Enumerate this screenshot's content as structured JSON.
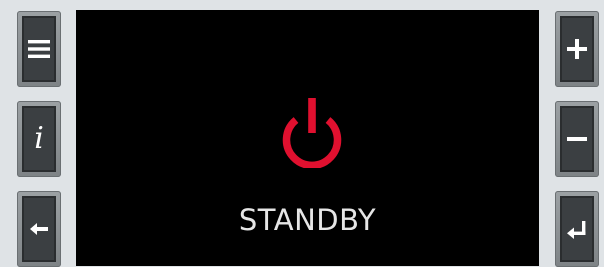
{
  "screen": {
    "status_label": "STANDBY",
    "power_icon": "power-icon",
    "power_color": "#e0102f",
    "background": "#000000"
  },
  "left_buttons": [
    {
      "name": "menu-button",
      "icon": "hamburger-menu-icon"
    },
    {
      "name": "info-button",
      "icon": "info-icon",
      "glyph": "i"
    },
    {
      "name": "back-button",
      "icon": "arrow-left-icon"
    }
  ],
  "right_buttons": [
    {
      "name": "plus-button",
      "icon": "plus-icon"
    },
    {
      "name": "minus-button",
      "icon": "minus-icon"
    },
    {
      "name": "enter-button",
      "icon": "enter-return-icon"
    }
  ],
  "colors": {
    "button_face": "#3b3f42",
    "button_frame": "#8a8f92",
    "icon": "#ffffff",
    "status_text": "#e6e6e6"
  }
}
